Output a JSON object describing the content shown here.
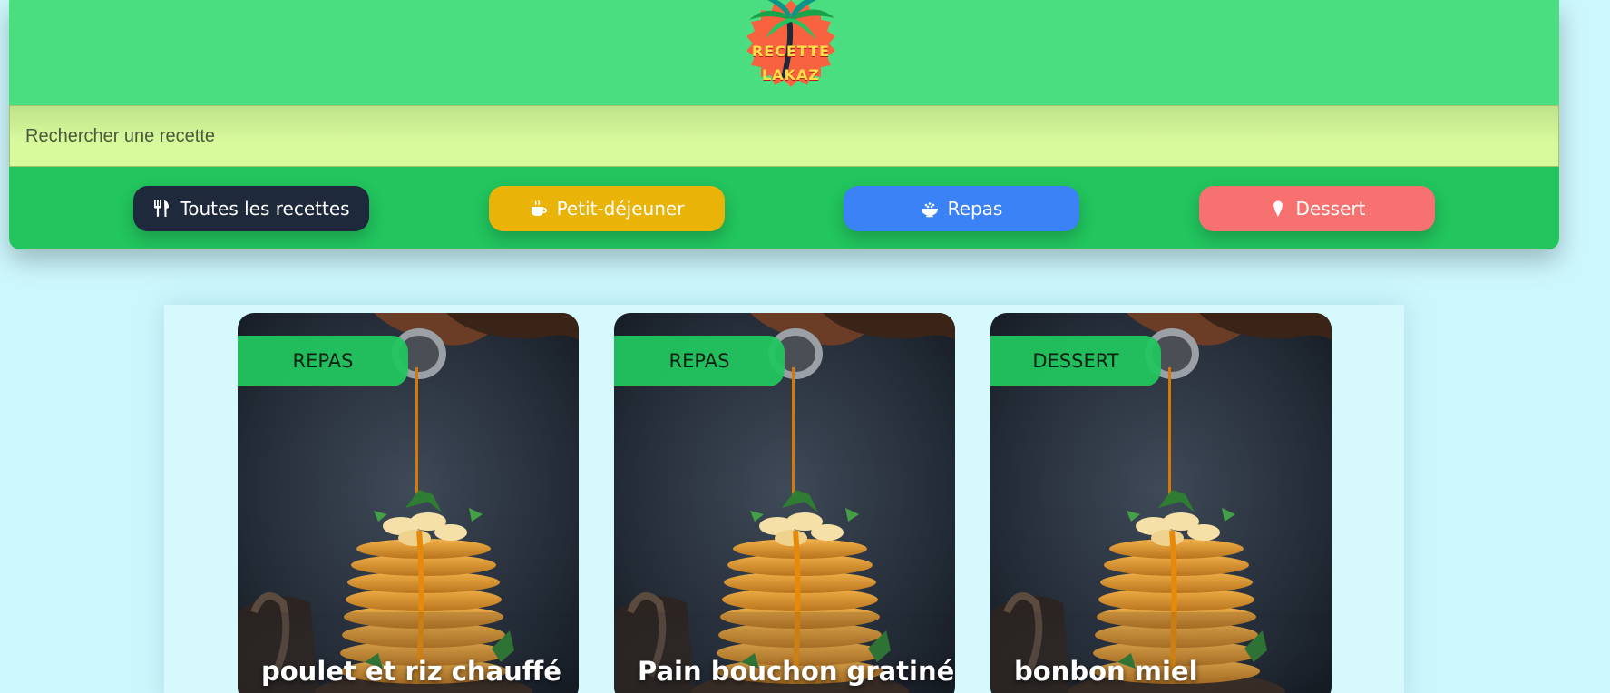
{
  "header": {
    "logo_line1": "RECETTE",
    "logo_line2": "LAKAZ"
  },
  "search": {
    "placeholder": "Rechercher une recette"
  },
  "categories": [
    {
      "label": "Toutes les recettes",
      "icon": "utensils-icon",
      "color": "#1e293b"
    },
    {
      "label": "Petit-déjeuner",
      "icon": "coffee-icon",
      "color": "#eab308"
    },
    {
      "label": "Repas",
      "icon": "bowl-icon",
      "color": "#3b82f6"
    },
    {
      "label": "Dessert",
      "icon": "ice-cream-icon",
      "color": "#f87171"
    }
  ],
  "recipes": [
    {
      "category": "REPAS",
      "title": "poulet et riz chauffé"
    },
    {
      "category": "REPAS",
      "title": "Pain bouchon gratiné"
    },
    {
      "category": "DESSERT",
      "title": "bonbon miel"
    }
  ],
  "colors": {
    "topbar": "#4ade80",
    "catbar": "#22c55e",
    "page_background": "#ccf7fd",
    "tag_background": "#22c55e"
  }
}
